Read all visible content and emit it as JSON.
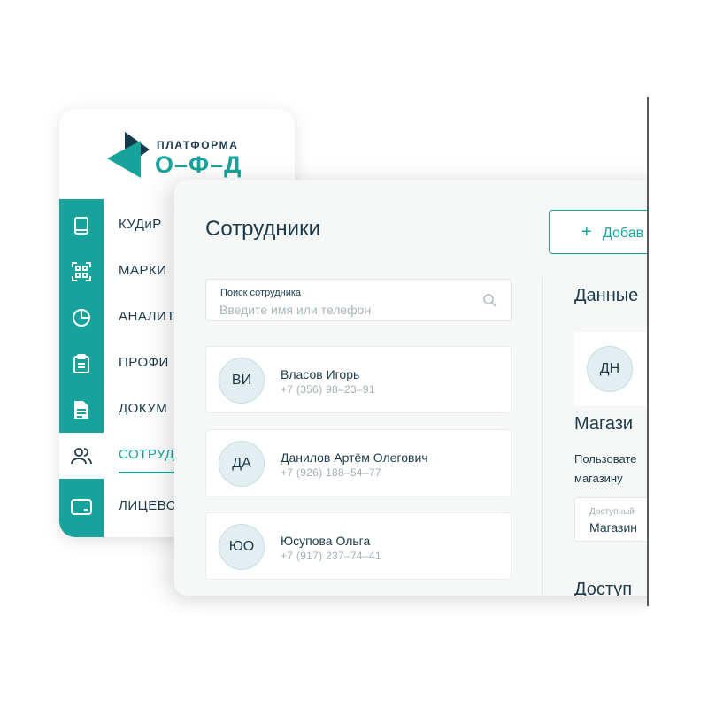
{
  "logo": {
    "top_text": "ПЛАТФОРМА",
    "bottom_text": "О–Ф–Д",
    "colors": {
      "dark": "#17394c",
      "teal": "#17a39b"
    }
  },
  "sidebar": {
    "accent": "#17a39b",
    "items": [
      {
        "label": "КУДиР",
        "icon": "book-icon",
        "active": false
      },
      {
        "label": "МАРКИ",
        "icon": "qr-code-icon",
        "active": false
      },
      {
        "label": "АНАЛИТ",
        "icon": "pie-chart-icon",
        "active": false
      },
      {
        "label": "ПРОФИ",
        "icon": "clipboard-icon",
        "active": false
      },
      {
        "label": "ДОКУМ",
        "icon": "document-icon",
        "active": false
      },
      {
        "label": "СОТРУД",
        "icon": "users-icon",
        "active": true
      },
      {
        "label": "ЛИЦЕВО",
        "icon": "wallet-icon",
        "active": false
      }
    ]
  },
  "main": {
    "title": "Сотрудники",
    "add_button": {
      "plus": "+",
      "label": "Добав"
    },
    "search": {
      "label": "Поиск сотрудника",
      "placeholder": "Введите имя или телефон",
      "icon": "search-icon"
    },
    "employees": [
      {
        "initials": "ВИ",
        "name": "Власов Игорь",
        "phone": "+7 (356) 98–23–91"
      },
      {
        "initials": "ДА",
        "name": "Данилов Артём Олегович",
        "phone": "+7 (926) 188–54–77"
      },
      {
        "initials": "ЮО",
        "name": "Юсупова Ольга",
        "phone": "+7 (917) 237–74–41"
      }
    ]
  },
  "details": {
    "data_title": "Данные",
    "avatar_initials": "ДН",
    "stores_title": "Магази",
    "stores_description": "Пользовате магазину",
    "select_label": "Доступный",
    "select_value": "Магазин",
    "access_title": "Доступ"
  }
}
